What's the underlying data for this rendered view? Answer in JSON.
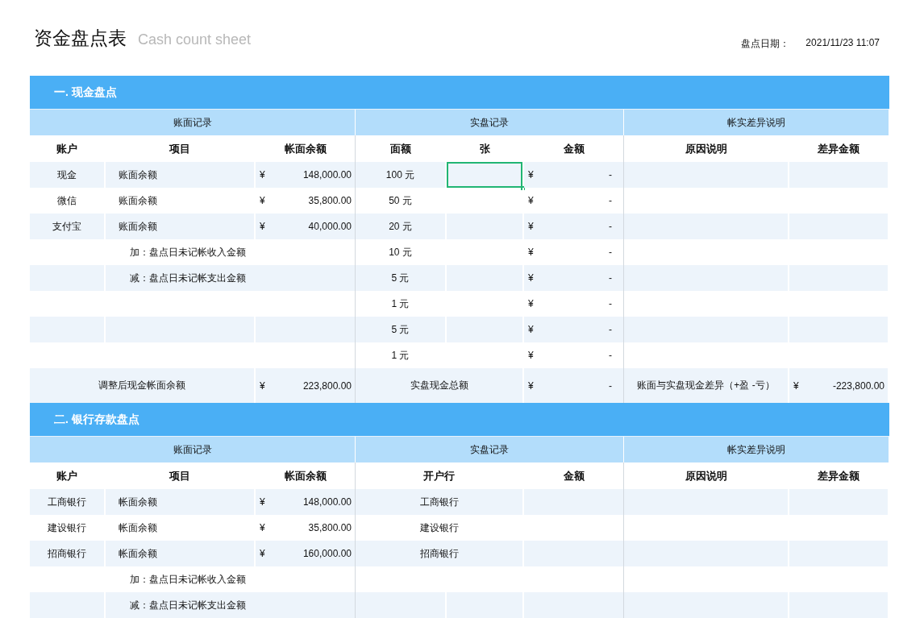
{
  "title": "资金盘点表",
  "subtitle": "Cash count sheet",
  "date_label": "盘点日期：",
  "date_value": "2021/11/23 11:07",
  "sections": [
    {
      "kind": "cash",
      "title": "一. 现金盘点",
      "groups": [
        "账面记录",
        "实盘记录",
        "帐实差异说明"
      ],
      "columns": [
        "账户",
        "项目",
        "帐面余额",
        "面额",
        "张",
        "金额",
        "原因说明",
        "差异金额"
      ],
      "rows": [
        {
          "kind": "account",
          "account": "现金",
          "item": "账面余额",
          "currency": "¥",
          "balance": "148,000.00",
          "denomination": "100 元",
          "count_selected": true,
          "amount_currency": "¥",
          "amount": "-"
        },
        {
          "kind": "account",
          "account": "微信",
          "item": "账面余额",
          "currency": "¥",
          "balance": "35,800.00",
          "denomination": "50 元",
          "count_selected": false,
          "amount_currency": "¥",
          "amount": "-"
        },
        {
          "kind": "account",
          "account": "支付宝",
          "item": "账面余额",
          "currency": "¥",
          "balance": "40,000.00",
          "denomination": "20 元",
          "count_selected": false,
          "amount_currency": "¥",
          "amount": "-"
        },
        {
          "kind": "adjust",
          "item": "加：盘点日未记帐收入金额",
          "denomination": "10 元",
          "count_selected": false,
          "amount_currency": "¥",
          "amount": "-"
        },
        {
          "kind": "adjust",
          "item": "减：盘点日未记帐支出金额",
          "denomination": "5 元",
          "count_selected": false,
          "amount_currency": "¥",
          "amount": "-"
        },
        {
          "kind": "blank",
          "denomination": "1 元",
          "count_selected": false,
          "amount_currency": "¥",
          "amount": "-"
        },
        {
          "kind": "blank",
          "denomination": "5 元",
          "count_selected": false,
          "amount_currency": "¥",
          "amount": "-"
        },
        {
          "kind": "blank",
          "denomination": "1 元",
          "count_selected": false,
          "amount_currency": "¥",
          "amount": "-"
        }
      ],
      "total": {
        "label": "调整后现金帐面余额",
        "currency": "¥",
        "balance": "223,800.00",
        "count_label": "实盘现金总额",
        "amount_currency": "¥",
        "amount": "-",
        "diff_label": "账面与实盘现金差异（+盈 -亏）",
        "diff_currency": "¥",
        "diff": "-223,800.00"
      }
    },
    {
      "kind": "bank",
      "title": "二. 银行存款盘点",
      "groups": [
        "账面记录",
        "实盘记录",
        "帐实差异说明"
      ],
      "columns": [
        "账户",
        "项目",
        "帐面余额",
        "开户行",
        "金额",
        "原因说明",
        "差异金额"
      ],
      "rows": [
        {
          "kind": "account",
          "account": "工商银行",
          "item": "帐面余额",
          "currency": "¥",
          "balance": "148,000.00",
          "bank": "工商银行"
        },
        {
          "kind": "account",
          "account": "建设银行",
          "item": "帐面余额",
          "currency": "¥",
          "balance": "35,800.00",
          "bank": "建设银行"
        },
        {
          "kind": "account",
          "account": "招商银行",
          "item": "帐面余额",
          "currency": "¥",
          "balance": "160,000.00",
          "bank": "招商银行"
        },
        {
          "kind": "adjust",
          "item": "加：盘点日未记帐收入金额"
        },
        {
          "kind": "adjust",
          "item": "减：盘点日未记帐支出金额"
        }
      ]
    }
  ]
}
